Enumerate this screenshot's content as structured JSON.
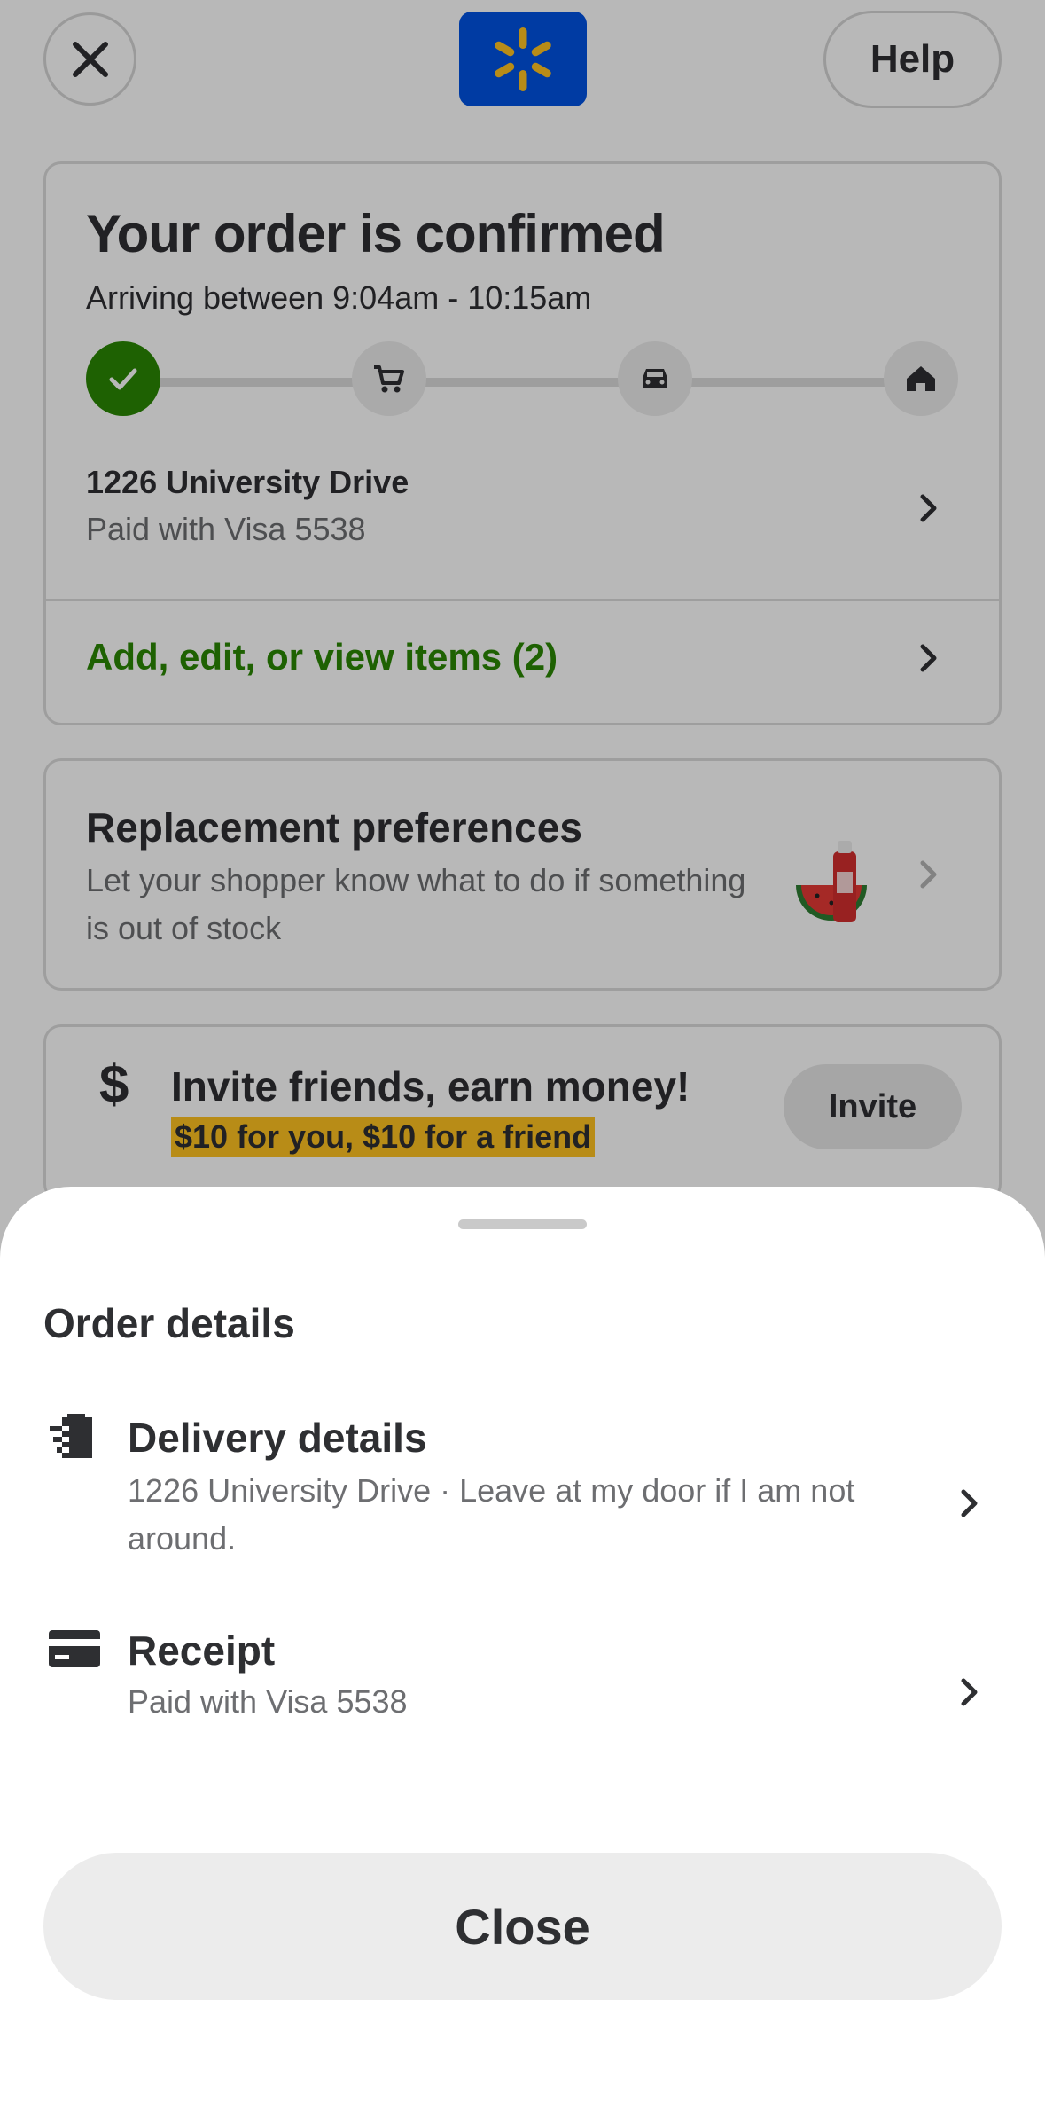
{
  "header": {
    "close_icon": "close-icon",
    "logo_icon": "walmart-spark-icon",
    "help_label": "Help",
    "brand_color": "#0053e2",
    "spark_color": "#ffc220"
  },
  "order": {
    "title": "Your order is confirmed",
    "arrival": "Arriving between 9:04am - 10:15am",
    "steps": [
      {
        "icon": "check-icon",
        "state": "complete"
      },
      {
        "icon": "cart-icon",
        "state": "pending"
      },
      {
        "icon": "car-icon",
        "state": "pending"
      },
      {
        "icon": "home-icon",
        "state": "pending"
      }
    ],
    "address": "1226 University Drive",
    "payment": "Paid with Visa 5538",
    "items_link": "Add, edit, or view items (2)",
    "accent_color": "#2a8703"
  },
  "replacement": {
    "title": "Replacement preferences",
    "body": "Let your shopper know what to do if something is out of stock"
  },
  "invite": {
    "title": "Invite friends, earn money!",
    "promo": "$10 for you, $10 for a friend",
    "button": "Invite",
    "icon": "dollar-icon"
  },
  "sheet": {
    "title": "Order details",
    "rows": [
      {
        "icon": "delivery-bag-icon",
        "title": "Delivery details",
        "subtitle": "1226 University Drive · Leave at my door if I am not around."
      },
      {
        "icon": "credit-card-icon",
        "title": "Receipt",
        "subtitle": "Paid with Visa 5538"
      }
    ],
    "close_label": "Close"
  }
}
